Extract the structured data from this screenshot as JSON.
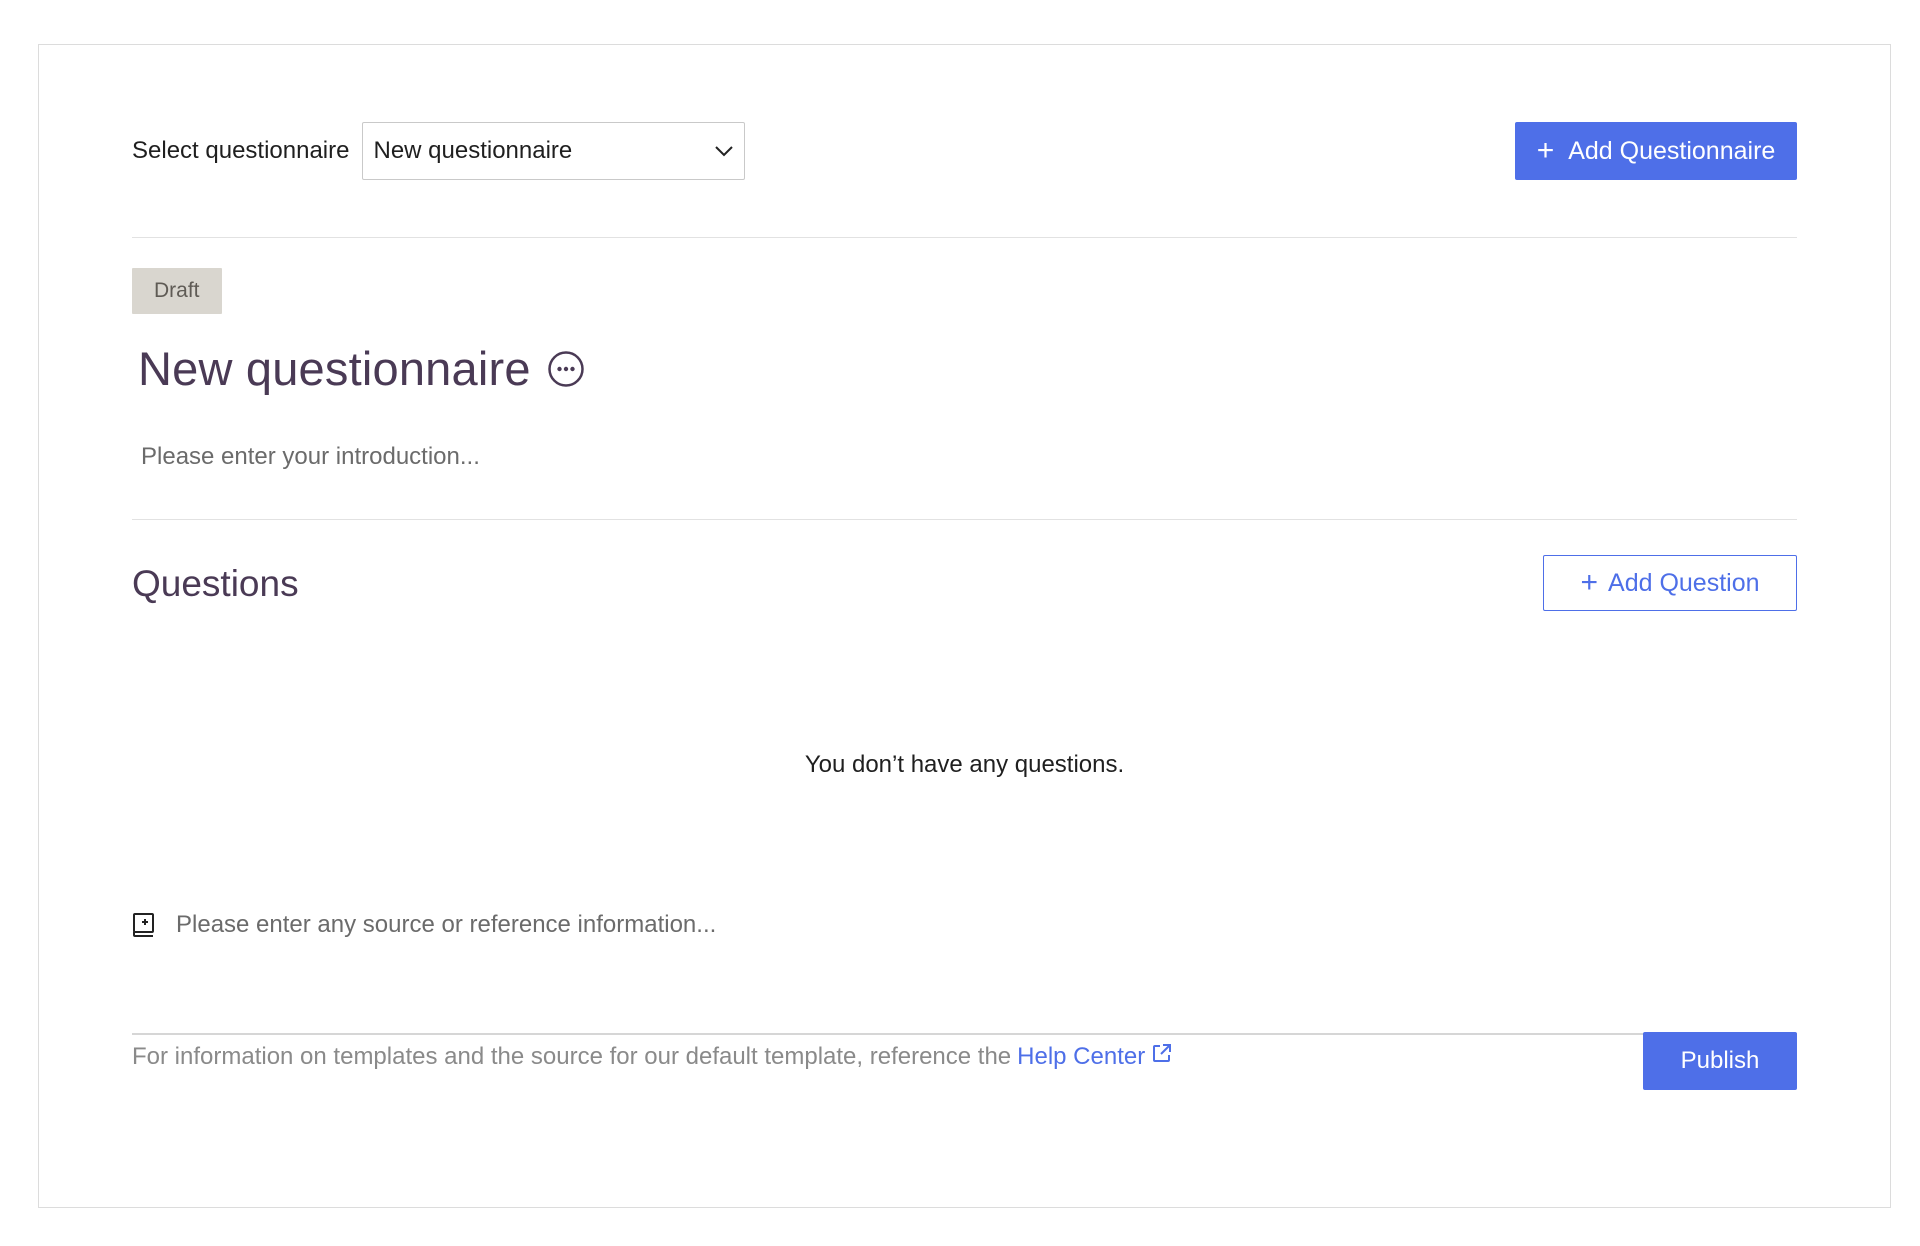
{
  "header": {
    "select_label": "Select questionnaire",
    "selected_value": "New questionnaire",
    "add_questionnaire_label": "Add Questionnaire"
  },
  "questionnaire": {
    "status": "Draft",
    "title": "New questionnaire",
    "intro_placeholder": "Please enter your introduction..."
  },
  "questions": {
    "heading": "Questions",
    "add_question_label": "Add Question",
    "empty_message": "You don’t have any questions."
  },
  "source": {
    "placeholder": "Please enter any source or reference information..."
  },
  "footer": {
    "note": "For information on templates and the source for our default template, reference the",
    "help_link": "Help Center",
    "publish_label": "Publish"
  },
  "colors": {
    "accent": "#4e6fe8",
    "title": "#4a3a55",
    "draft_badge": "#d9d6cf"
  }
}
